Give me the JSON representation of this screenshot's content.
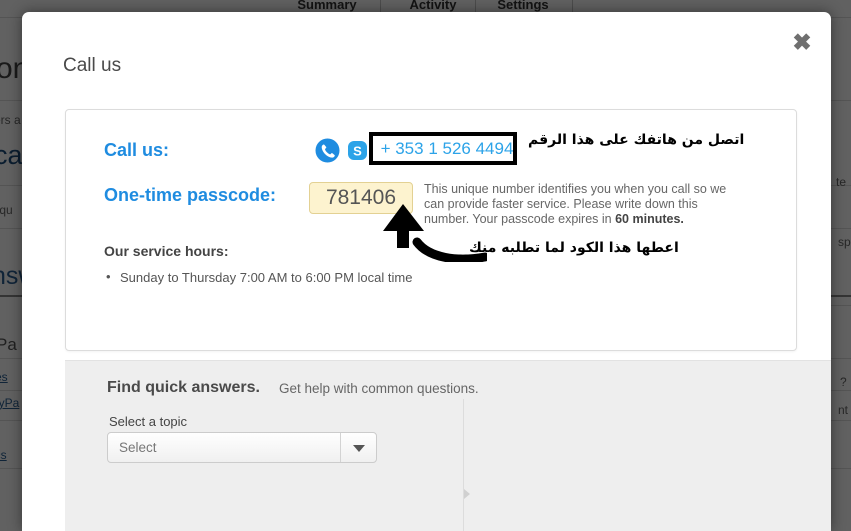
{
  "background": {
    "tabs": [
      {
        "label": "Summary"
      },
      {
        "label": "Activity"
      },
      {
        "label": "Settings"
      }
    ],
    "fragments": {
      "heading_clipped": "on",
      "line_clipped": "ers a",
      "subheading_clipped": "ca",
      "question_clipped": "r qu",
      "answers_clipped": "nsw",
      "link1_clipped": "Pa",
      "link2_clipped": "es",
      "link3_clipped": "ayPa",
      "link4_clipped": "ics",
      "right1_clipped": "te",
      "right2_clipped": "sp",
      "right3_clipped": "?",
      "right4_clipped": "nt"
    }
  },
  "modal": {
    "title": "Call us",
    "close_icon": "close-icon",
    "call_card": {
      "call_label": "Call us:",
      "phone_icon": "phone-icon",
      "skype_icon": "skype-icon",
      "phone_number": "+ 353 1 526 4494",
      "annotation_arabic_phone": "اتصل من هاتفك على هذا الرقم",
      "passcode_label": "One-time passcode:",
      "passcode_value": "781406",
      "passcode_description_part1": "This unique number identifies you when you call so we can provide faster service. Please write down this number. Your passcode expires in ",
      "passcode_description_bold": "60 minutes.",
      "annotation_arabic_passcode": "اعطها هذا الكود لما تطلبه منك",
      "annotation_arrow_icon": "curved-arrow-icon",
      "service_hours_label": "Our service hours:",
      "service_hours": [
        "Sunday to Thursday 7:00 AM to 6:00 PM local time"
      ]
    },
    "faq_panel": {
      "heading": "Find quick answers.",
      "subheading": "Get help with common questions.",
      "topic_field_label": "Select a topic",
      "topic_select_value": "Select",
      "topic_caret_icon": "chevron-down-icon"
    }
  },
  "colors": {
    "accent_blue": "#1f8ce0",
    "phone_blue": "#2ca3e8",
    "passcode_bg": "#fdf3cf",
    "passcode_border": "#e3d193",
    "panel_gray": "#eeeeee",
    "annotation_black": "#000000"
  }
}
